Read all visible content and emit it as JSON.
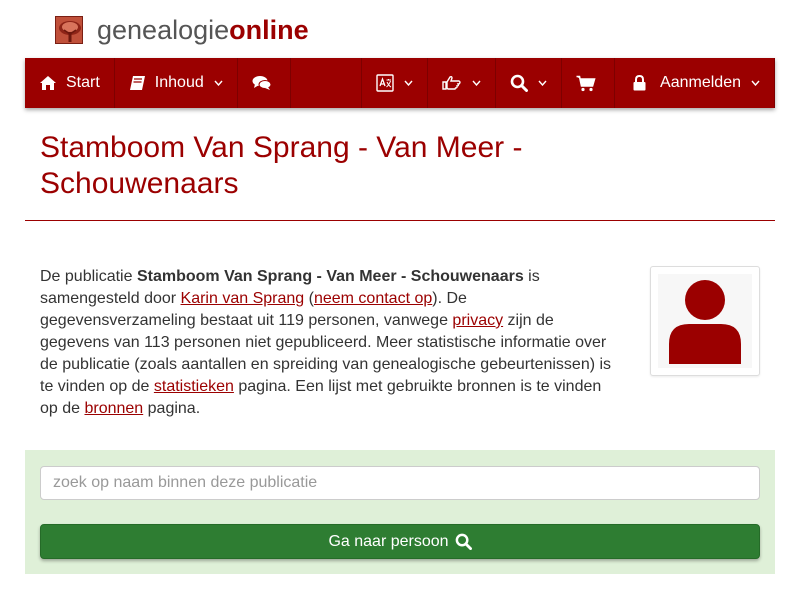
{
  "brand": {
    "name_part1": "genealogie",
    "name_part2": "online",
    "logo_icon": "tree-icon"
  },
  "nav": {
    "start_label": "Start",
    "inhoud_label": "Inhoud",
    "login_label": "Aanmelden",
    "icons": [
      "home-icon",
      "book-icon",
      "comments-icon",
      "language-icon",
      "hand-point-icon",
      "search-icon",
      "cart-icon",
      "lock-icon"
    ]
  },
  "page": {
    "title": "Stamboom Van Sprang - Van Meer - Schouwenaars"
  },
  "description": {
    "t1": "De publicatie ",
    "pub_name": "Stamboom Van Sprang - Van Meer - Schouwenaars",
    "t2": " is samengesteld door ",
    "author": "Karin van Sprang",
    "t3": " (",
    "contact": "neem contact op",
    "t4": "). De gegevensverzameling bestaat uit 119 personen, vanwege ",
    "privacy": "privacy",
    "t5": " zijn de gegevens van 113 personen niet gepubliceerd. Meer statistische informatie over de publicatie (zoals aantallen en spreiding van genealogische gebeurtenissen) is te vinden op de ",
    "stats": "statistieken",
    "t6": " pagina. Een lijst met gebruikte bronnen is te vinden op de ",
    "sources": "bronnen",
    "t7": " pagina."
  },
  "search": {
    "placeholder": "zoek op naam binnen deze publicatie",
    "button_label": "Ga naar persoon"
  },
  "colors": {
    "brand": "#9b0000",
    "panel": "#dff0d8",
    "button": "#2e7d32"
  }
}
